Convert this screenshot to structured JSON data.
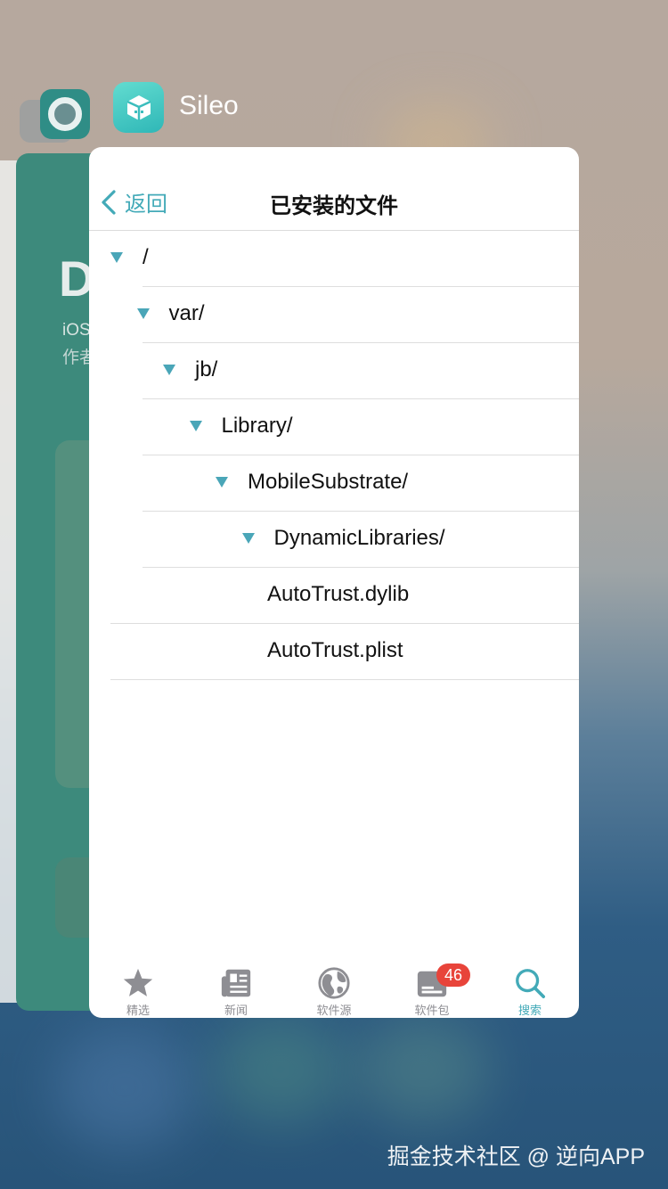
{
  "switcher": {
    "app_name": "Sileo"
  },
  "behind_card": {
    "big_letter": "D",
    "line1": "iOS",
    "line2": "作者"
  },
  "navbar": {
    "back_label": "返回",
    "title": "已安装的文件"
  },
  "tree": [
    {
      "label": "/",
      "expanded": true,
      "depth": 0
    },
    {
      "label": "var/",
      "expanded": true,
      "depth": 1
    },
    {
      "label": "jb/",
      "expanded": true,
      "depth": 2
    },
    {
      "label": "Library/",
      "expanded": true,
      "depth": 3
    },
    {
      "label": "MobileSubstrate/",
      "expanded": true,
      "depth": 4
    },
    {
      "label": "DynamicLibraries/",
      "expanded": true,
      "depth": 5
    },
    {
      "label": "AutoTrust.dylib",
      "expanded": false,
      "depth": 6
    },
    {
      "label": "AutoTrust.plist",
      "expanded": false,
      "depth": 6
    }
  ],
  "tabbar": {
    "tabs": [
      {
        "label": "精选",
        "icon": "star-icon",
        "active": false
      },
      {
        "label": "新闻",
        "icon": "newspaper-icon",
        "active": false
      },
      {
        "label": "软件源",
        "icon": "globe-icon",
        "active": false
      },
      {
        "label": "软件包",
        "icon": "package-icon",
        "active": false,
        "badge": "46"
      },
      {
        "label": "搜索",
        "icon": "search-icon",
        "active": true
      }
    ]
  },
  "colors": {
    "accent": "#43aab8",
    "badge": "#e8443a"
  },
  "watermark": "掘金技术社区 @ 逆向APP"
}
